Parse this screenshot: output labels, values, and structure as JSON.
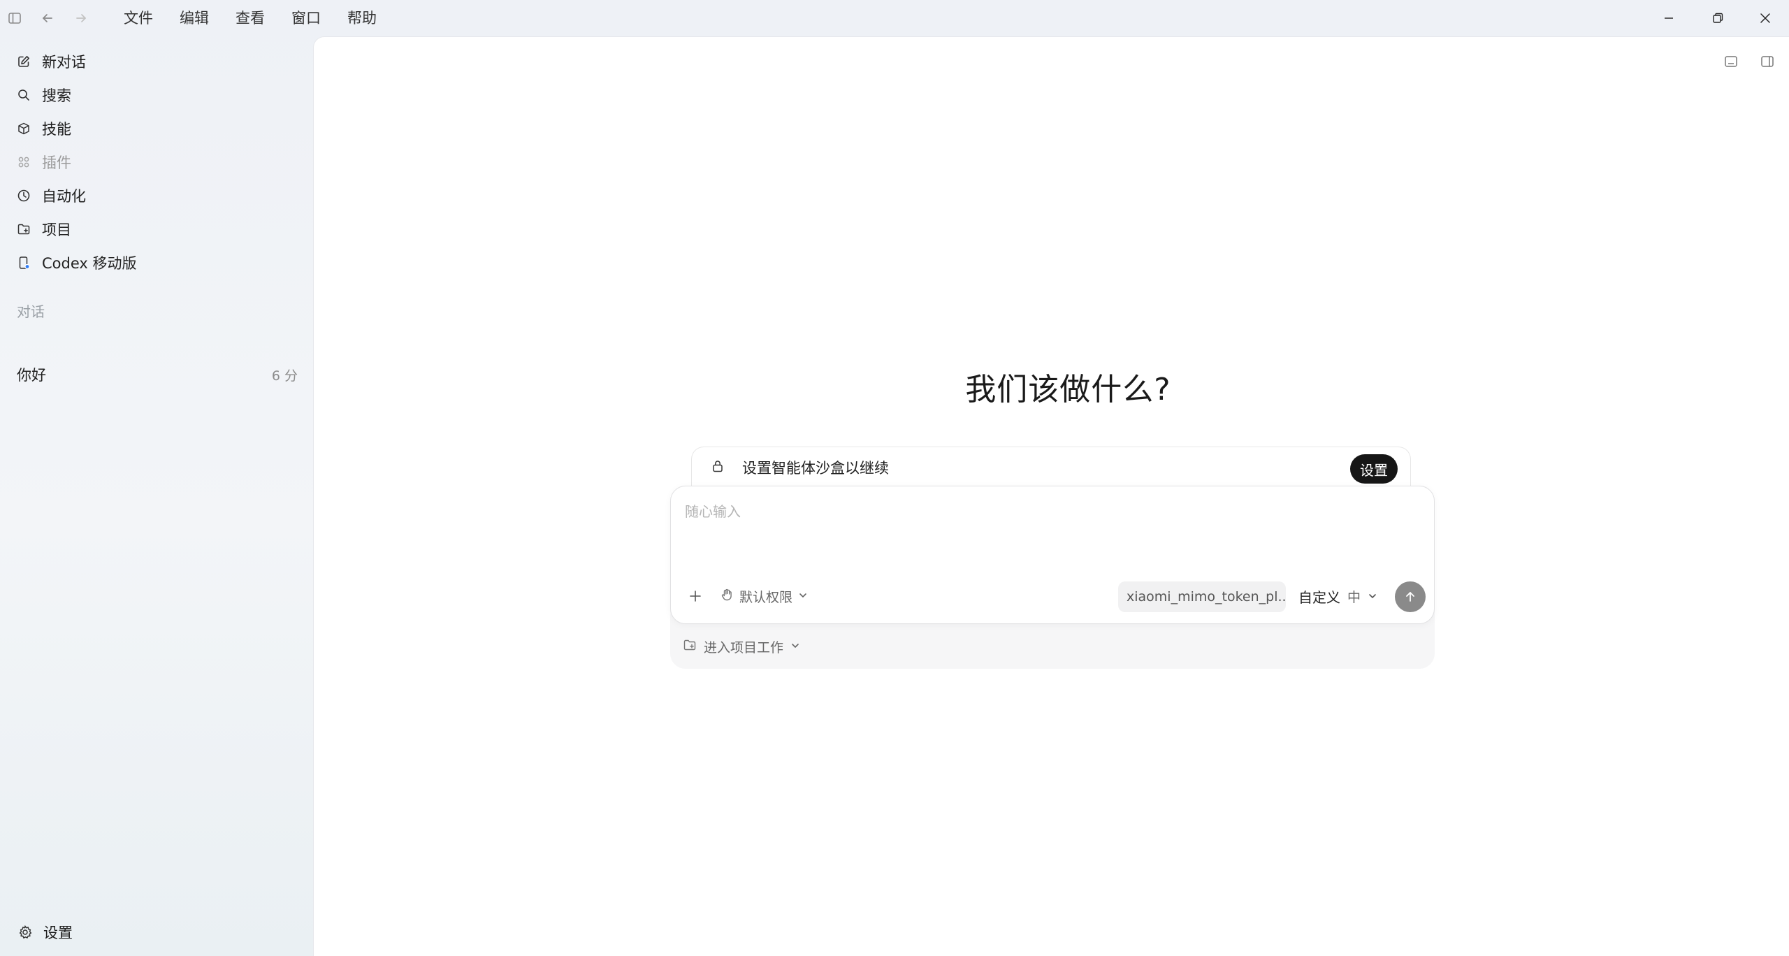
{
  "menu": [
    "文件",
    "编辑",
    "查看",
    "窗口",
    "帮助"
  ],
  "sidebar": {
    "items": [
      {
        "label": "新对话",
        "icon": "edit-icon"
      },
      {
        "label": "搜索",
        "icon": "search-icon"
      },
      {
        "label": "技能",
        "icon": "cube-icon"
      },
      {
        "label": "插件",
        "icon": "grid-icon"
      },
      {
        "label": "自动化",
        "icon": "clock-icon"
      },
      {
        "label": "项目",
        "icon": "folder-icon"
      },
      {
        "label": "Codex 移动版",
        "icon": "phone-icon"
      }
    ],
    "section_label": "对话",
    "conversations": [
      {
        "title": "你好",
        "time": "6 分"
      }
    ],
    "settings_label": "设置"
  },
  "main": {
    "headline": "我们该做什么?",
    "sandbox": {
      "text": "设置智能体沙盒以继续",
      "button": "设置"
    },
    "composer": {
      "placeholder": "随心输入",
      "permission": "默认权限",
      "model": "xiaomi_mimo_token_pl...",
      "mode": "自定义",
      "level": "中"
    },
    "project_label": "进入项目工作"
  },
  "colors": {
    "sidebar_bg": "#eef1f5",
    "main_bg": "#ffffff",
    "sandbox_button_bg": "#161616",
    "send_button_bg": "#8a8a8a",
    "mobile_dot": "#2f7cf6"
  }
}
